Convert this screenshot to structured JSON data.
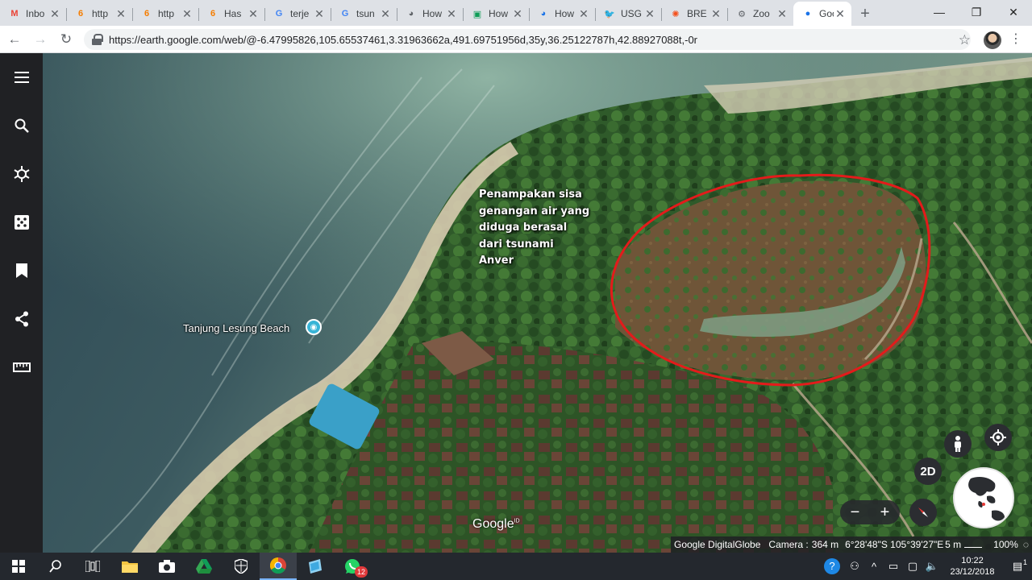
{
  "browser": {
    "tabs": [
      {
        "label": "Inbo",
        "icon": "gmail-icon",
        "color": "#ea4335",
        "glyph": "M"
      },
      {
        "label": "http",
        "icon": "blogger-icon",
        "color": "#f57d00",
        "glyph": "6"
      },
      {
        "label": "http",
        "icon": "blogger-icon",
        "color": "#f57d00",
        "glyph": "6"
      },
      {
        "label": "Has",
        "icon": "blogger-icon",
        "color": "#f57d00",
        "glyph": "6"
      },
      {
        "label": "terje",
        "icon": "google-icon",
        "color": "#4285f4",
        "glyph": "G"
      },
      {
        "label": "tsun",
        "icon": "google-icon",
        "color": "#4285f4",
        "glyph": "G"
      },
      {
        "label": "How",
        "icon": "globe-icon",
        "color": "#5f6368",
        "glyph": "◕"
      },
      {
        "label": "How",
        "icon": "sheets-icon",
        "color": "#0f9d58",
        "glyph": "▣"
      },
      {
        "label": "How",
        "icon": "globe-icon",
        "color": "#1a73e8",
        "glyph": "◕"
      },
      {
        "label": "USG",
        "icon": "twitter-icon",
        "color": "#1da1f2",
        "glyph": "🐦"
      },
      {
        "label": "BRE",
        "icon": "news-icon",
        "color": "#f4511e",
        "glyph": "✺"
      },
      {
        "label": "Zoo",
        "icon": "globe-icon",
        "color": "#5f6368",
        "glyph": "⚙"
      },
      {
        "label": "Goo",
        "icon": "google-earth-icon",
        "color": "#1a73e8",
        "glyph": "●",
        "active": true
      }
    ],
    "new_tab": "+",
    "window": {
      "minimize": "—",
      "restore": "❐",
      "close": "✕"
    },
    "nav": {
      "back": "←",
      "forward": "→",
      "reload": "↻"
    },
    "url": "https://earth.google.com/web/@-6.47995826,105.65537461,3.31963662a,491.69751956d,35y,36.25122787h,42.88927088t,-0r",
    "bookmark": "☆",
    "menu": "⋮"
  },
  "earth": {
    "rail": [
      "menu-icon",
      "search-icon",
      "voyager-icon",
      "feeling-lucky-icon",
      "projects-icon",
      "share-icon",
      "measure-icon"
    ],
    "place_label": "Tanjung Lesung Beach",
    "annotation_lines": [
      "Penampakan sisa",
      "genangan air yang",
      "diduga berasal",
      "dari tsunami",
      "Anver"
    ],
    "watermark": "Google",
    "watermark_sup": "ID",
    "controls": {
      "view_2d": "2D",
      "zoom_out": "−",
      "zoom_in": "+"
    },
    "status": {
      "attribution": "Google DigitalGlobe",
      "camera": "Camera :",
      "altitude": "364 m",
      "coords": "6°28'48\"S 105°39'27\"E",
      "scale": "5 m",
      "progress": "100%"
    }
  },
  "taskbar": {
    "apps": [
      {
        "name": "start-icon"
      },
      {
        "name": "search-icon"
      },
      {
        "name": "task-view-icon"
      },
      {
        "name": "file-explorer-icon"
      },
      {
        "name": "camera-icon"
      },
      {
        "name": "drive-icon"
      },
      {
        "name": "defender-icon"
      },
      {
        "name": "chrome-icon",
        "active": true
      },
      {
        "name": "notepad-icon"
      },
      {
        "name": "whatsapp-icon",
        "badge": "12"
      }
    ],
    "time": "10:22",
    "date": "23/12/2018",
    "notifications": "1"
  }
}
